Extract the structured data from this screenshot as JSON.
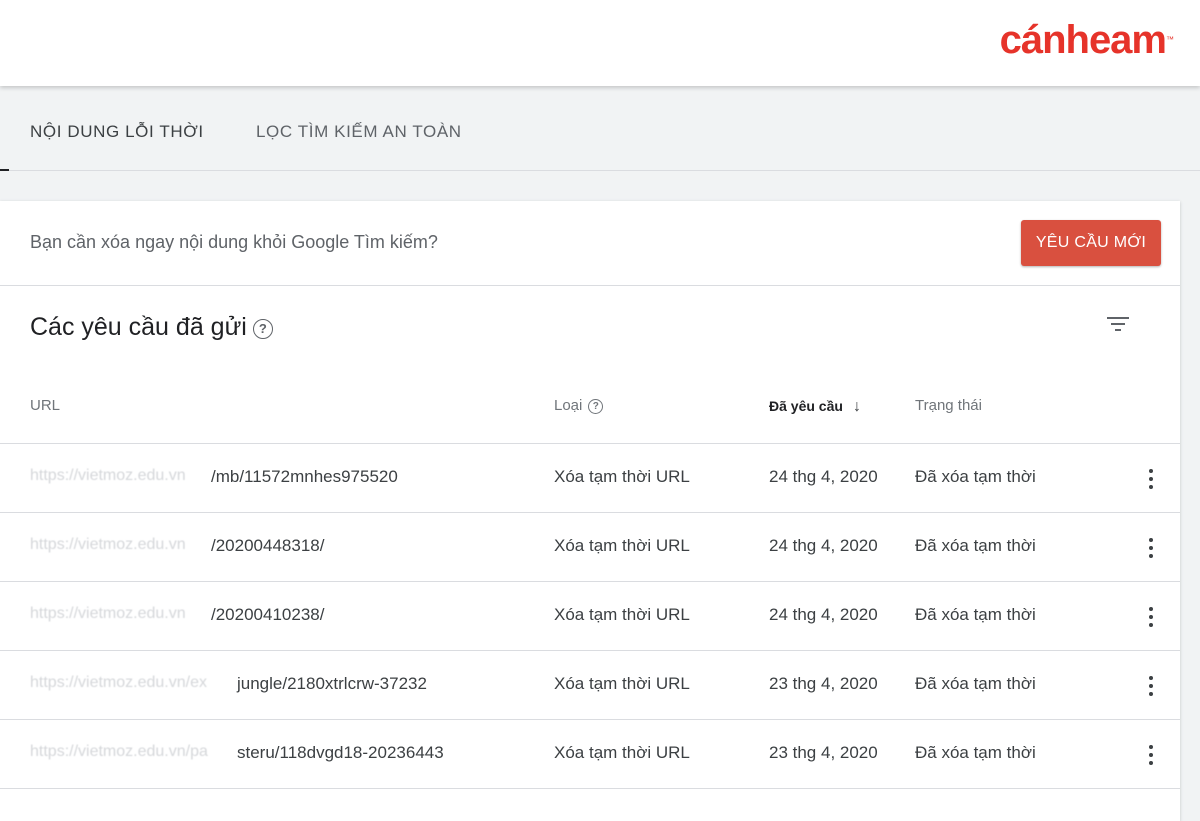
{
  "brand": {
    "logo_text": "cánheam",
    "logo_tm": "™",
    "accent_color": "#e6332a"
  },
  "tabs": [
    {
      "label": "NỘI DUNG LỖI THỜI"
    },
    {
      "label": "LỌC TÌM KIẾM AN TOÀN"
    }
  ],
  "banner": {
    "text": "Bạn cần xóa ngay nội dung khỏi Google Tìm kiếm?",
    "new_request_label": "YÊU CẦU MỚI",
    "button_color": "#d9503f"
  },
  "section": {
    "title": "Các yêu cầu đã gửi",
    "help_icon": "?",
    "filter_icon": "filter-icon"
  },
  "table": {
    "headers": {
      "url": "URL",
      "type": "Loại",
      "type_help": "?",
      "date": "Đã yêu cầu",
      "date_sort": "↓",
      "status": "Trạng thái"
    },
    "rows": [
      {
        "url_prefix": "https://vietmoz.edu.vn",
        "url_path": "/mb/11572mnhes975520",
        "type": "Xóa tạm thời URL",
        "date": "24 thg 4, 2020",
        "status": "Đã xóa tạm thời"
      },
      {
        "url_prefix": "https://vietmoz.edu.vn",
        "url_path": "/20200448318/",
        "type": "Xóa tạm thời URL",
        "date": "24 thg 4, 2020",
        "status": "Đã xóa tạm thời"
      },
      {
        "url_prefix": "https://vietmoz.edu.vn",
        "url_path": "/20200410238/",
        "type": "Xóa tạm thời URL",
        "date": "24 thg 4, 2020",
        "status": "Đã xóa tạm thời"
      },
      {
        "url_prefix": "https://vietmoz.edu.vn/ex",
        "url_path": "jungle/2180xtrlcrw-37232",
        "type": "Xóa tạm thời URL",
        "date": "23 thg 4, 2020",
        "status": "Đã xóa tạm thời"
      },
      {
        "url_prefix": "https://vietmoz.edu.vn/pa",
        "url_path": "steru/118dvgd18-20236443",
        "type": "Xóa tạm thời URL",
        "date": "23 thg 4, 2020",
        "status": "Đã xóa tạm thời"
      }
    ]
  }
}
